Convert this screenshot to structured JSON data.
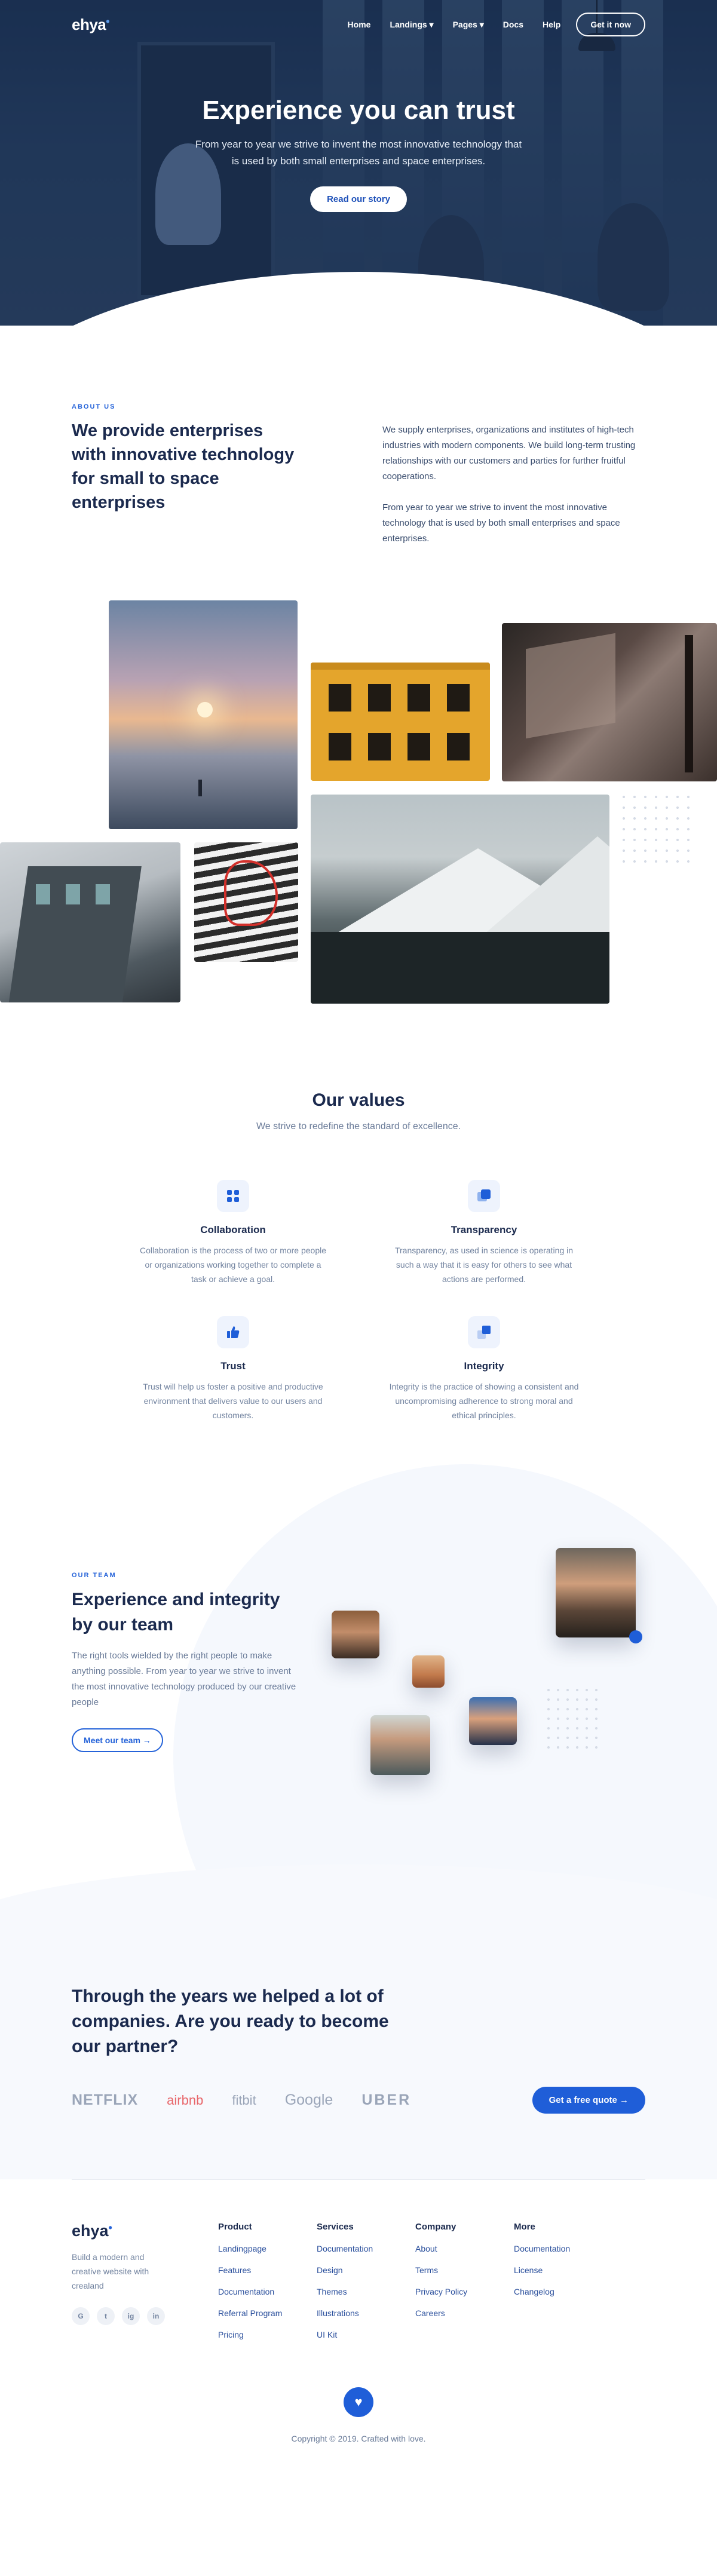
{
  "nav": {
    "logo": "ehya",
    "logo_mark": "•",
    "links": [
      {
        "label": "Home"
      },
      {
        "label": "Landings ▾"
      },
      {
        "label": "Pages ▾"
      },
      {
        "label": "Docs"
      },
      {
        "label": "Help"
      }
    ],
    "cta": "Get it now"
  },
  "hero": {
    "title": "Experience you can trust",
    "subtitle": "From year to year we strive to invent the most innovative technology that is used by both small enterprises and space enterprises.",
    "button": "Read our story"
  },
  "about": {
    "eyebrow": "ABOUT US",
    "title": "We provide enterprises with innovative technology for small to space enterprises",
    "paragraph1": "We supply enterprises, organizations and institutes of high-tech industries with modern components. We build long-term trusting relationships with our customers and parties for further fruitful cooperations.",
    "paragraph2": "From year to year we strive to invent the most innovative technology that is used by both small enterprises and space enterprises."
  },
  "values": {
    "title": "Our values",
    "subtitle": "We strive to redefine the standard of excellence.",
    "items": [
      {
        "title": "Collaboration",
        "text": "Collaboration is the process of two or more people or organizations working together to complete a task or achieve a goal.",
        "icon": "grid-icon"
      },
      {
        "title": "Transparency",
        "text": "Transparency, as used in science is operating in such a way that it is easy for others to see what actions are performed.",
        "icon": "layers-icon"
      },
      {
        "title": "Trust",
        "text": "Trust will help us foster a positive and productive environment that delivers value to our users and customers.",
        "icon": "thumbs-up-icon"
      },
      {
        "title": "Integrity",
        "text": "Integrity is the practice of showing a consistent and uncompromising adherence to strong moral and ethical principles.",
        "icon": "stack-icon"
      }
    ]
  },
  "team": {
    "eyebrow": "OUR TEAM",
    "title": "Experience and integrity by our team",
    "text": "The right tools wielded by the right people to make anything possible. From year to year we strive to invent the most innovative technology produced by our creative people",
    "button": "Meet our team →"
  },
  "partners": {
    "title": "Through the years we helped a lot of companies. Are you ready to become our partner?",
    "logos": [
      "NETFLIX",
      "airbnb",
      "fitbit",
      "Google",
      "UBER"
    ],
    "button": "Get a free quote →"
  },
  "footer": {
    "logo": "ehya",
    "logo_mark": "•",
    "description": "Build a modern and creative website with crealand",
    "socials": [
      "G",
      "t",
      "ig",
      "in"
    ],
    "columns": [
      {
        "title": "Product",
        "links": [
          "Landingpage",
          "Features",
          "Documentation",
          "Referral Program",
          "Pricing"
        ]
      },
      {
        "title": "Services",
        "links": [
          "Documentation",
          "Design",
          "Themes",
          "Illustrations",
          "UI Kit"
        ]
      },
      {
        "title": "Company",
        "links": [
          "About",
          "Terms",
          "Privacy Policy",
          "Careers"
        ]
      },
      {
        "title": "More",
        "links": [
          "Documentation",
          "License",
          "Changelog"
        ]
      }
    ],
    "heart": "♥",
    "copyright": "Copyright © 2019. Crafted with love."
  },
  "colors": {
    "primary": "#1f5ed8",
    "heading": "#1b2a4e",
    "muted": "#7384a0",
    "hero_overlay": "#162c50"
  }
}
